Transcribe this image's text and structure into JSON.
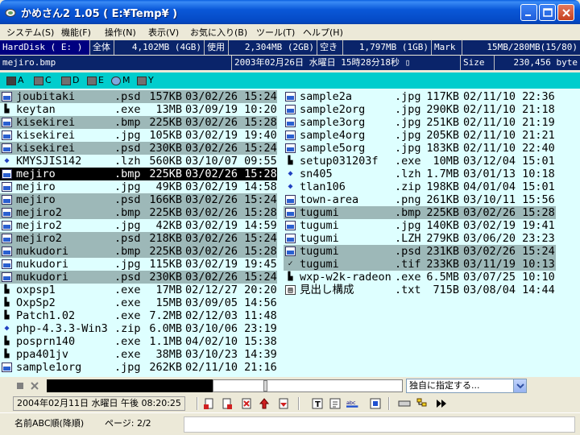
{
  "window": {
    "title": "かめさん2 1.05 ( E:¥Temp¥ )"
  },
  "menu": [
    "システム(S)",
    "機能(F)",
    "操作(N)",
    "表示(V)",
    "お気に入り(B)",
    "ツール(T)",
    "ヘルプ(H)"
  ],
  "info_row1": {
    "disk": "HardDisk ( E: )",
    "total_label": "全体",
    "total_value": "4,102MB (4GB)",
    "used_label": "使用",
    "used_value": "2,304MB (2GB)",
    "free_label": "空き",
    "free_value": "1,797MB (1GB)",
    "mark_label": "Mark",
    "mark_value": "15MB/280MB(15/80)"
  },
  "info_row2": {
    "filename": "mejiro.bmp",
    "datetime": "2003年02月26日 水曜日 15時28分18秒 ▯",
    "size_label": "Size",
    "size_value": "230,456 byte"
  },
  "drives": [
    "A",
    "C",
    "D",
    "E",
    "M",
    "Y"
  ],
  "files_left": [
    {
      "name": "joubitaki",
      "ext": ".psd",
      "size": "157KB",
      "date": "03/02/26 15:24",
      "icon": "image-icon",
      "hl": true
    },
    {
      "name": "keytan",
      "ext": ".exe",
      "size": "13MB",
      "date": "03/09/19 10:20",
      "icon": "exe-icon",
      "hl": false
    },
    {
      "name": "kisekirei",
      "ext": ".bmp",
      "size": "225KB",
      "date": "03/02/26 15:28",
      "icon": "image-icon",
      "hl": true
    },
    {
      "name": "kisekirei",
      "ext": ".jpg",
      "size": "105KB",
      "date": "03/02/19 19:40",
      "icon": "image-icon",
      "hl": false
    },
    {
      "name": "kisekirei",
      "ext": ".psd",
      "size": "230KB",
      "date": "03/02/26 15:24",
      "icon": "image-icon",
      "hl": true
    },
    {
      "name": "KMYSJIS142",
      "ext": ".lzh",
      "size": "560KB",
      "date": "03/10/07 09:55",
      "icon": "archive-icon",
      "hl": false
    },
    {
      "name": "mejiro",
      "ext": ".bmp",
      "size": "225KB",
      "date": "03/02/26 15:28",
      "icon": "image-icon",
      "hl": false,
      "cur": true
    },
    {
      "name": "mejiro",
      "ext": ".jpg",
      "size": "49KB",
      "date": "03/02/19 14:58",
      "icon": "image-icon",
      "hl": false
    },
    {
      "name": "mejiro",
      "ext": ".psd",
      "size": "166KB",
      "date": "03/02/26 15:24",
      "icon": "image-icon",
      "hl": true
    },
    {
      "name": "mejiro2",
      "ext": ".bmp",
      "size": "225KB",
      "date": "03/02/26 15:28",
      "icon": "image-icon",
      "hl": true
    },
    {
      "name": "mejiro2",
      "ext": ".jpg",
      "size": "42KB",
      "date": "03/02/19 14:59",
      "icon": "image-icon",
      "hl": false
    },
    {
      "name": "mejiro2",
      "ext": ".psd",
      "size": "218KB",
      "date": "03/02/26 15:24",
      "icon": "image-icon",
      "hl": true
    },
    {
      "name": "mukudori",
      "ext": ".bmp",
      "size": "225KB",
      "date": "03/02/26 15:28",
      "icon": "image-icon",
      "hl": true
    },
    {
      "name": "mukudori",
      "ext": ".jpg",
      "size": "115KB",
      "date": "03/02/19 19:45",
      "icon": "image-icon",
      "hl": false
    },
    {
      "name": "mukudori",
      "ext": ".psd",
      "size": "230KB",
      "date": "03/02/26 15:24",
      "icon": "image-icon",
      "hl": true
    },
    {
      "name": "oxpsp1",
      "ext": ".exe",
      "size": "17MB",
      "date": "02/12/27 20:20",
      "icon": "exe-icon",
      "hl": false
    },
    {
      "name": "OxpSp2",
      "ext": ".exe",
      "size": "15MB",
      "date": "03/09/05 14:56",
      "icon": "exe-icon",
      "hl": false
    },
    {
      "name": "Patch1.02",
      "ext": ".exe",
      "size": "7.2MB",
      "date": "02/12/03 11:48",
      "icon": "exe-icon",
      "hl": false
    },
    {
      "name": "php-4.3.3-Win3",
      "ext": ".zip",
      "size": "6.0MB",
      "date": "03/10/06 23:19",
      "icon": "zip-icon",
      "hl": false
    },
    {
      "name": "posprn140",
      "ext": ".exe",
      "size": "1.1MB",
      "date": "04/02/10 15:38",
      "icon": "exe-icon",
      "hl": false
    },
    {
      "name": "ppa401jv",
      "ext": ".exe",
      "size": "38MB",
      "date": "03/10/23 14:39",
      "icon": "exe-icon",
      "hl": false
    },
    {
      "name": "sample1org",
      "ext": ".jpg",
      "size": "262KB",
      "date": "02/11/10 21:16",
      "icon": "image-icon",
      "hl": false
    }
  ],
  "files_right": [
    {
      "name": "sample2a",
      "ext": ".jpg",
      "size": "117KB",
      "date": "02/11/10 22:36",
      "icon": "image-icon",
      "hl": false
    },
    {
      "name": "sample2org",
      "ext": ".jpg",
      "size": "290KB",
      "date": "02/11/10 21:18",
      "icon": "image-icon",
      "hl": false
    },
    {
      "name": "sample3org",
      "ext": ".jpg",
      "size": "251KB",
      "date": "02/11/10 21:19",
      "icon": "image-icon",
      "hl": false
    },
    {
      "name": "sample4org",
      "ext": ".jpg",
      "size": "205KB",
      "date": "02/11/10 21:21",
      "icon": "image-icon",
      "hl": false
    },
    {
      "name": "sample5org",
      "ext": ".jpg",
      "size": "183KB",
      "date": "02/11/10 22:40",
      "icon": "image-icon",
      "hl": false
    },
    {
      "name": "setup031203f",
      "ext": ".exe",
      "size": "10MB",
      "date": "03/12/04 15:01",
      "icon": "exe-icon",
      "hl": false
    },
    {
      "name": "sn405",
      "ext": ".lzh",
      "size": "1.7MB",
      "date": "03/01/13 10:18",
      "icon": "archive-icon",
      "hl": false
    },
    {
      "name": "tlan106",
      "ext": ".zip",
      "size": "198KB",
      "date": "04/01/04 15:01",
      "icon": "zip-icon",
      "hl": false
    },
    {
      "name": "town-area",
      "ext": ".png",
      "size": "261KB",
      "date": "03/10/11 15:56",
      "icon": "image-icon",
      "hl": false
    },
    {
      "name": "tugumi",
      "ext": ".bmp",
      "size": "225KB",
      "date": "03/02/26 15:28",
      "icon": "image-icon",
      "hl": true
    },
    {
      "name": "tugumi",
      "ext": ".jpg",
      "size": "140KB",
      "date": "03/02/19 19:41",
      "icon": "image-icon",
      "hl": false
    },
    {
      "name": "tugumi",
      "ext": ".LZH",
      "size": "279KB",
      "date": "03/06/20 23:23",
      "icon": "image-icon",
      "hl": false
    },
    {
      "name": "tugumi",
      "ext": ".psd",
      "size": "231KB",
      "date": "03/02/26 15:24",
      "icon": "image-icon",
      "hl": true
    },
    {
      "name": "tugumi",
      "ext": ".tif",
      "size": "233KB",
      "date": "03/11/19 10:13",
      "icon": "check-icon",
      "hl": true
    },
    {
      "name": "wxp-w2k-radeon",
      "ext": ".exe",
      "size": "6.5MB",
      "date": "03/07/25 10:10",
      "icon": "exe-icon",
      "hl": false
    },
    {
      "name": "見出し構成",
      "ext": ".txt",
      "size": "715B",
      "date": "03/08/04 14:44",
      "icon": "text-file-icon",
      "hl": false
    }
  ],
  "progress": {
    "filter_value": "独自に指定する..."
  },
  "toolbar": {
    "date_value": "2004年02月11日 水曜日 午後 08:20:25"
  },
  "status": {
    "sort": "名前ABC順(降順)",
    "page": "ページ: 2/2"
  },
  "colors": {
    "list_bg": "#DEFFFF",
    "highlight": "#9DB8B8",
    "drivebar": "#00CDCD",
    "infobar": "#0A246A"
  }
}
